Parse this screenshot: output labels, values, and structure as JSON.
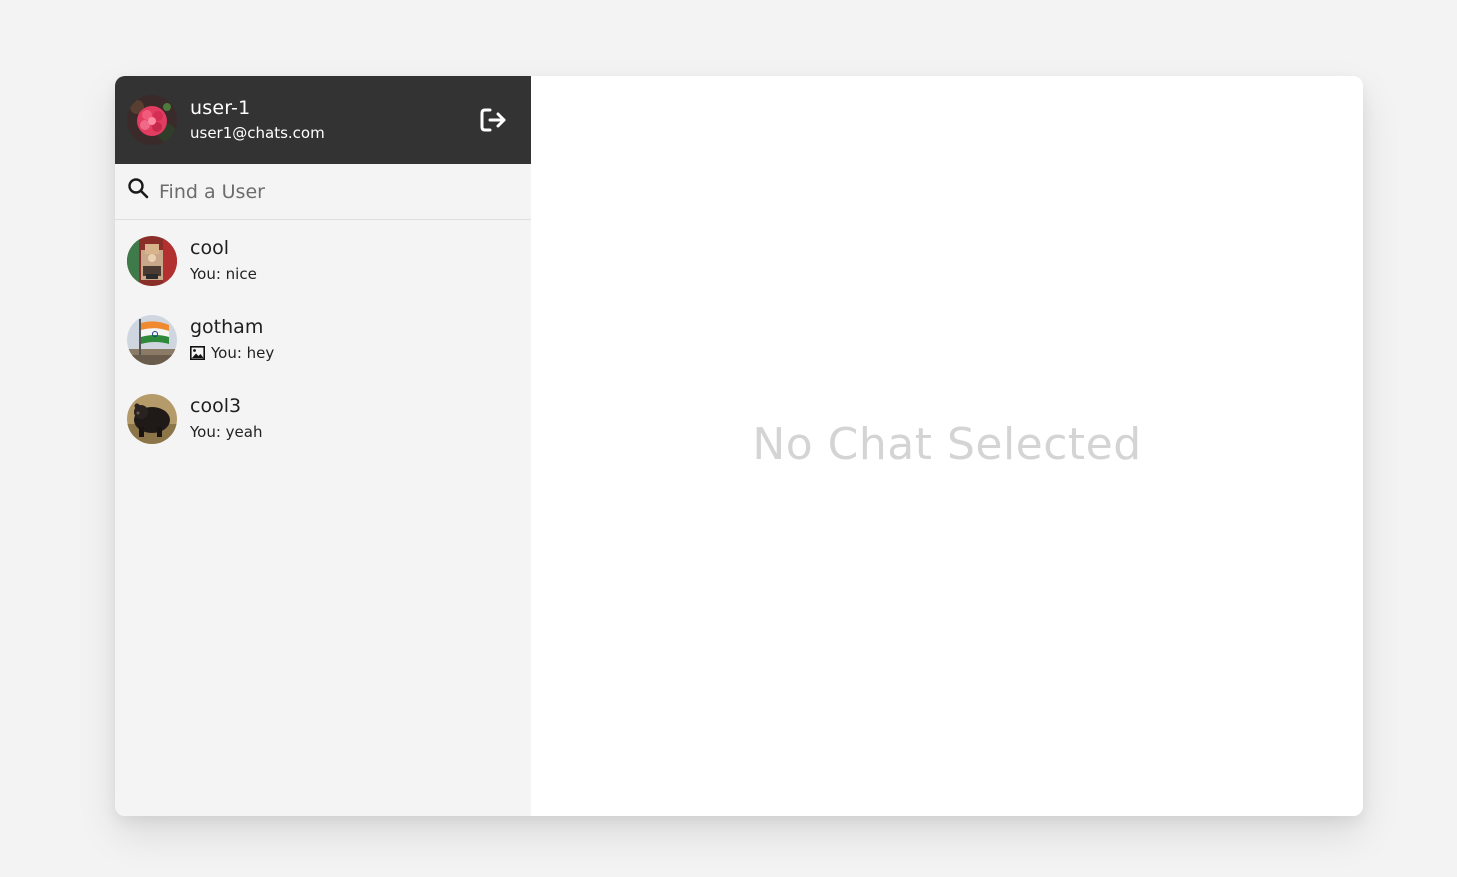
{
  "current_user": {
    "name": "user-1",
    "email": "user1@chats.com",
    "avatar": "flower-avatar"
  },
  "header": {
    "logout_icon": "logout-icon"
  },
  "search": {
    "icon": "search-icon",
    "placeholder": "Find a User",
    "value": ""
  },
  "chats": [
    {
      "name": "cool",
      "preview": "You: nice",
      "avatar": "shrine-avatar",
      "has_photo_icon": false
    },
    {
      "name": "gotham",
      "preview": "You: hey",
      "avatar": "flag-avatar",
      "has_photo_icon": true
    },
    {
      "name": "cool3",
      "preview": "You: yeah",
      "avatar": "bear-avatar",
      "has_photo_icon": false
    }
  ],
  "main": {
    "empty_message": "No Chat Selected"
  },
  "colors": {
    "page_background": "#f3f3f3",
    "header_background": "#333333",
    "sidebar_background": "#f4f4f4",
    "main_background": "#ffffff",
    "empty_text": "#d4d4d4"
  }
}
